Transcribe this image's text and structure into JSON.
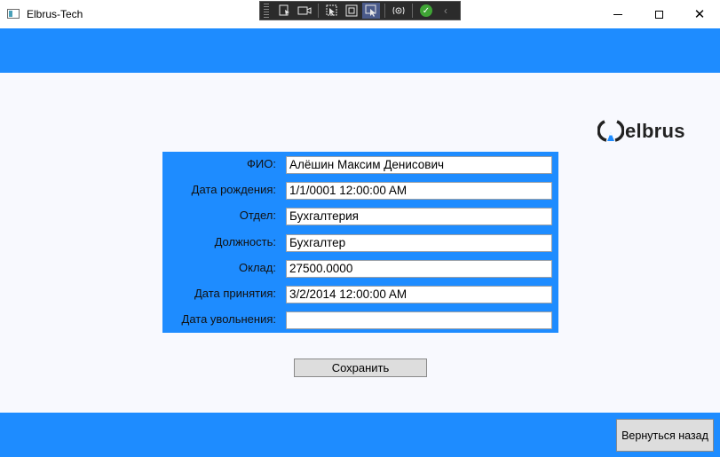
{
  "window": {
    "title": "Elbrus-Tech",
    "minimize_icon": "minimize-icon",
    "maximize_icon": "maximize-icon",
    "close_icon": "close-icon"
  },
  "debug_toolbar": {
    "items": [
      "select-element-icon",
      "video-icon",
      "pointer-icon",
      "frame-icon",
      "track-focus-icon",
      "hot-reload-icon",
      "check-icon",
      "chevron-left-icon"
    ]
  },
  "logo": {
    "text": "elbrus"
  },
  "form": {
    "fields": [
      {
        "label": "ФИО:",
        "value": "Алёшин Максим Денисович"
      },
      {
        "label": "Дата рождения:",
        "value": "1/1/0001 12:00:00 AM"
      },
      {
        "label": "Отдел:",
        "value": "Бухгалтерия"
      },
      {
        "label": "Должность:",
        "value": "Бухгалтер"
      },
      {
        "label": "Оклад:",
        "value": "27500.0000"
      },
      {
        "label": "Дата принятия:",
        "value": "3/2/2014 12:00:00 AM"
      },
      {
        "label": "Дата увольнения:",
        "value": ""
      }
    ]
  },
  "buttons": {
    "save": "Сохранить",
    "back": "Вернуться назад"
  },
  "colors": {
    "accent": "#1e8cff",
    "background": "#f8f9fe",
    "button": "#dddddd"
  }
}
